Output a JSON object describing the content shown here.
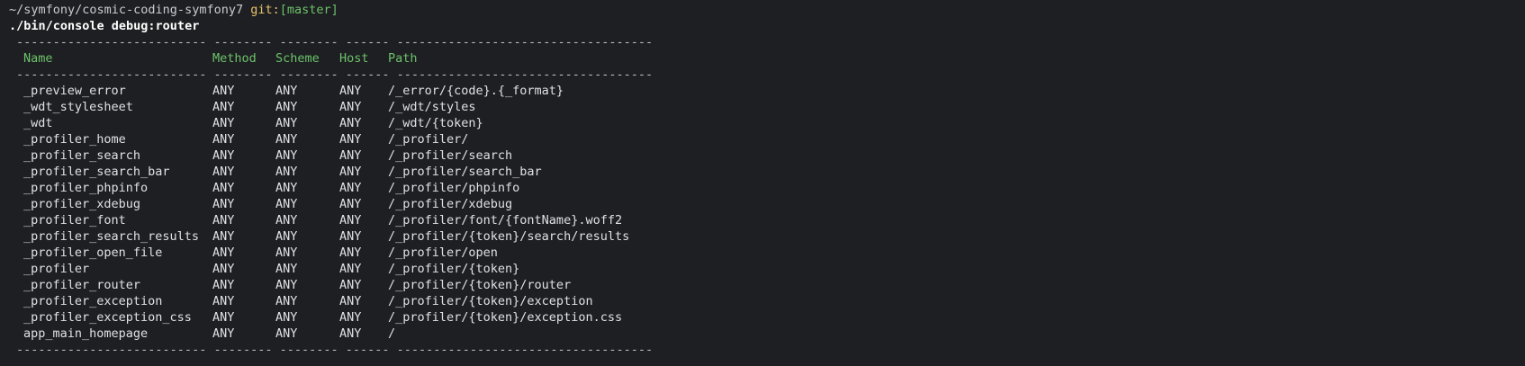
{
  "prompt": {
    "cwd": "~/symfony/cosmic-coding-symfony7",
    "git_label": "git:",
    "branch": "[master]"
  },
  "command": "./bin/console debug:router",
  "separator": "-------------------------- -------- -------- ------ -----------------------------------",
  "headers": {
    "name": "Name",
    "method": "Method",
    "scheme": "Scheme",
    "host": "Host",
    "path": "Path"
  },
  "routes": [
    {
      "name": "_preview_error",
      "method": "ANY",
      "scheme": "ANY",
      "host": "ANY",
      "path": "/_error/{code}.{_format}"
    },
    {
      "name": "_wdt_stylesheet",
      "method": "ANY",
      "scheme": "ANY",
      "host": "ANY",
      "path": "/_wdt/styles"
    },
    {
      "name": "_wdt",
      "method": "ANY",
      "scheme": "ANY",
      "host": "ANY",
      "path": "/_wdt/{token}"
    },
    {
      "name": "_profiler_home",
      "method": "ANY",
      "scheme": "ANY",
      "host": "ANY",
      "path": "/_profiler/"
    },
    {
      "name": "_profiler_search",
      "method": "ANY",
      "scheme": "ANY",
      "host": "ANY",
      "path": "/_profiler/search"
    },
    {
      "name": "_profiler_search_bar",
      "method": "ANY",
      "scheme": "ANY",
      "host": "ANY",
      "path": "/_profiler/search_bar"
    },
    {
      "name": "_profiler_phpinfo",
      "method": "ANY",
      "scheme": "ANY",
      "host": "ANY",
      "path": "/_profiler/phpinfo"
    },
    {
      "name": "_profiler_xdebug",
      "method": "ANY",
      "scheme": "ANY",
      "host": "ANY",
      "path": "/_profiler/xdebug"
    },
    {
      "name": "_profiler_font",
      "method": "ANY",
      "scheme": "ANY",
      "host": "ANY",
      "path": "/_profiler/font/{fontName}.woff2"
    },
    {
      "name": "_profiler_search_results",
      "method": "ANY",
      "scheme": "ANY",
      "host": "ANY",
      "path": "/_profiler/{token}/search/results"
    },
    {
      "name": "_profiler_open_file",
      "method": "ANY",
      "scheme": "ANY",
      "host": "ANY",
      "path": "/_profiler/open"
    },
    {
      "name": "_profiler",
      "method": "ANY",
      "scheme": "ANY",
      "host": "ANY",
      "path": "/_profiler/{token}"
    },
    {
      "name": "_profiler_router",
      "method": "ANY",
      "scheme": "ANY",
      "host": "ANY",
      "path": "/_profiler/{token}/router"
    },
    {
      "name": "_profiler_exception",
      "method": "ANY",
      "scheme": "ANY",
      "host": "ANY",
      "path": "/_profiler/{token}/exception"
    },
    {
      "name": "_profiler_exception_css",
      "method": "ANY",
      "scheme": "ANY",
      "host": "ANY",
      "path": "/_profiler/{token}/exception.css"
    },
    {
      "name": "app_main_homepage",
      "method": "ANY",
      "scheme": "ANY",
      "host": "ANY",
      "path": "/"
    }
  ],
  "colors": {
    "background": "#1e1f22",
    "text": "#dfe1e5",
    "header_green": "#6cc26a",
    "git_yellow": "#e8c46a"
  }
}
